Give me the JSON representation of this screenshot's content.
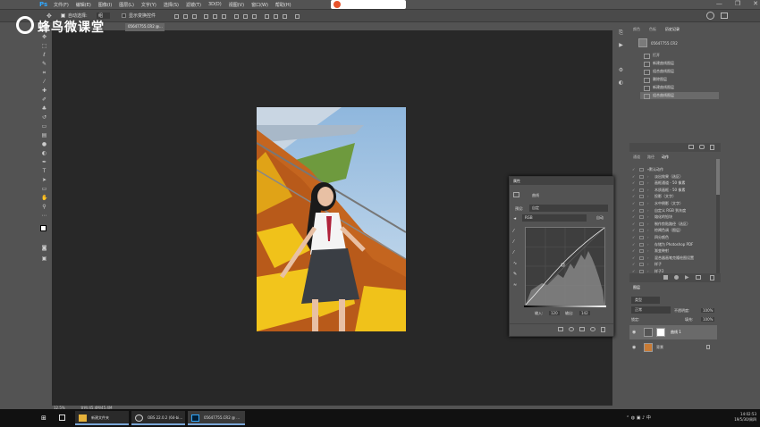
{
  "app": {
    "logo": "Ps",
    "accent": "#31a8ff"
  },
  "menu": [
    "文件(F)",
    "编辑(E)",
    "图像(I)",
    "图层(L)",
    "文字(Y)",
    "选择(S)",
    "滤镜(T)",
    "3D(D)",
    "视图(V)",
    "窗口(W)",
    "帮助(H)"
  ],
  "window_controls": [
    "—",
    "❐",
    "✕"
  ],
  "options": {
    "auto_select": "自动选择:",
    "auto_select_target": "组",
    "show_transform": "显示变换控件"
  },
  "watermark": "蜂鸟微课堂",
  "document_tab": "05647755.CR2 @...",
  "status": {
    "zoom": "12.5%",
    "doc": "文档:45.4M/45.4M"
  },
  "history_panel": {
    "tabs": [
      "颜色",
      "色板",
      "历史记录"
    ],
    "snapshot": "05647755.CR2",
    "items": [
      "打开",
      "新建曲线图层",
      "组合曲线图层",
      "删除图层",
      "新建曲线图层",
      "组合曲线图层"
    ]
  },
  "actions_panel": {
    "tabs": [
      "通道",
      "路径",
      "动作"
    ],
    "items": [
      "默认动作",
      "淡出效果（选区）",
      "画框通道 - 50 像素",
      "木质画框 - 50 像素",
      "投影（文字）",
      "水中倒影（文字）",
      "自定义 RGB 到灰度",
      "熔化的铅块",
      "制作剪贴路径（选区）",
      "棕褐色调（图层）",
      "四分颜色",
      "存储为 Photoshop PDF",
      "渐变映射",
      "混合器画笔克隆绘图设置",
      "样子",
      "样子2"
    ]
  },
  "layers_panel": {
    "title": "图层",
    "kind": "类型",
    "mode": "正常",
    "opacity_label": "不透明度:",
    "opacity": "100%",
    "lock_label": "锁定:",
    "fill_label": "填充:",
    "fill": "100%",
    "layers": [
      {
        "name": "曲线 1",
        "selected": true
      },
      {
        "name": "背景",
        "selected": false
      }
    ]
  },
  "properties_panel": {
    "title": "属性",
    "type": "曲线",
    "preset_label": "预设:",
    "preset": "自定",
    "channel": "RGB",
    "auto_button": "自动",
    "input_label": "输入:",
    "input": "120",
    "output_label": "输出:",
    "output": "142"
  },
  "taskbar": {
    "items": [
      "新建文件夹",
      "OBS 22.0.2 (64-bi...",
      "05647755.CR2 @ ..."
    ],
    "time": "14:02:53",
    "date": "19/5/30/周四"
  }
}
